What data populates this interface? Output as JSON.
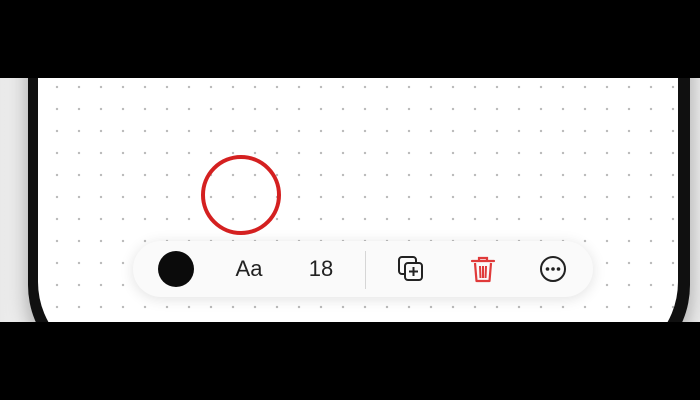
{
  "toolbar": {
    "color": "#0b0b0b",
    "font_label": "Aa",
    "size_label": "18",
    "icons": {
      "duplicate": "duplicate-icon",
      "delete": "trash-icon",
      "more": "more-options-icon"
    },
    "delete_color": "#e03a3a"
  },
  "annotation": {
    "highlight_color": "#d42020",
    "highlight_target": "font-button"
  }
}
